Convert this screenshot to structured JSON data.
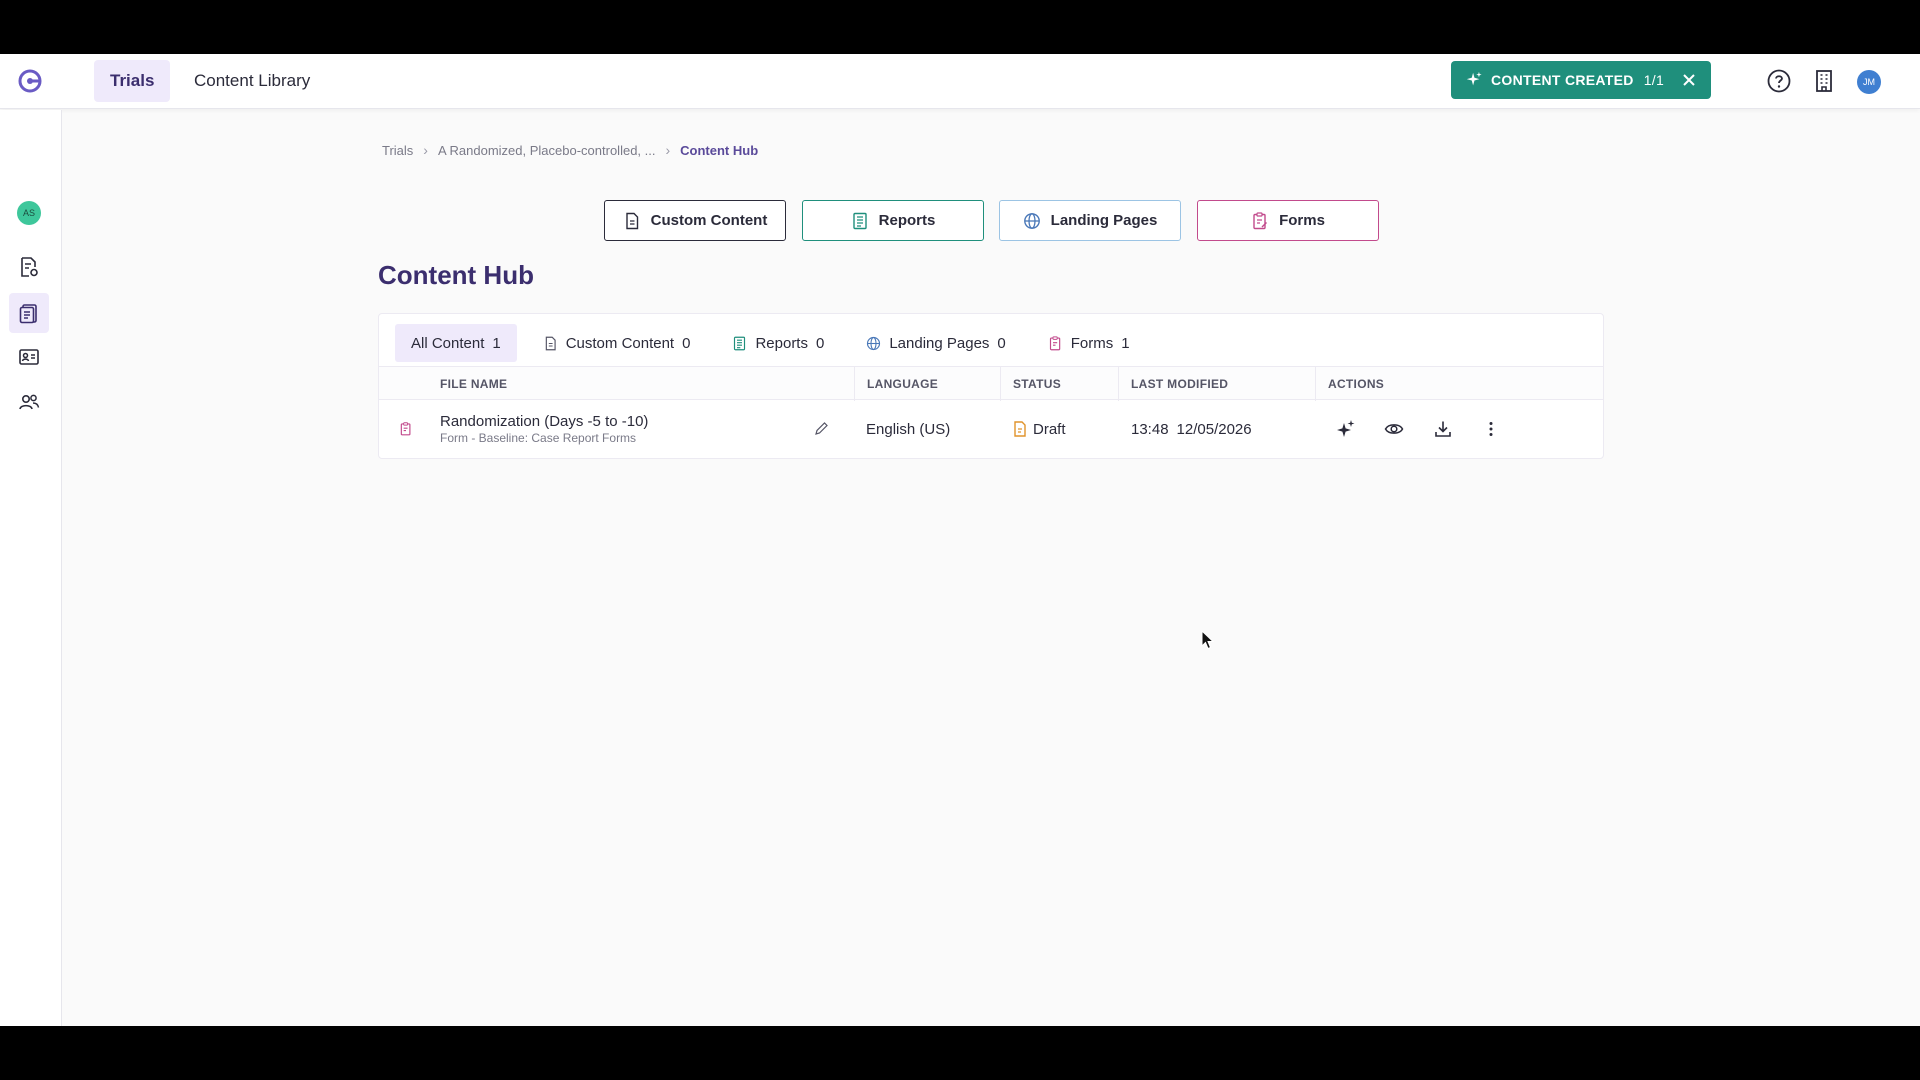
{
  "topbar": {
    "tabs": [
      {
        "label": "Trials",
        "active": true
      },
      {
        "label": "Content Library",
        "active": false
      }
    ],
    "toast": {
      "label": "CONTENT CREATED",
      "count": "1/1"
    },
    "user_initials": "JM"
  },
  "sidebar": {
    "user_initials": "AS",
    "items": [
      {
        "icon": "document-settings-icon"
      },
      {
        "icon": "clipboard-icon",
        "active": true
      },
      {
        "icon": "id-card-icon"
      },
      {
        "icon": "users-icon"
      }
    ]
  },
  "breadcrumb": {
    "items": [
      "Trials",
      "A Randomized, Placebo-controlled, ...",
      "Content Hub"
    ]
  },
  "create_buttons": [
    {
      "label": "Custom Content",
      "icon": "document-icon",
      "color": "#2b2b3a"
    },
    {
      "label": "Reports",
      "icon": "report-icon",
      "color": "#1f8f7c"
    },
    {
      "label": "Landing Pages",
      "icon": "globe-icon",
      "color": "#4a78b8"
    },
    {
      "label": "Forms",
      "icon": "form-icon",
      "color": "#c24a8c"
    }
  ],
  "page_title": "Content Hub",
  "filters": [
    {
      "label": "All Content",
      "count": "1",
      "active": true
    },
    {
      "label": "Custom Content",
      "count": "0"
    },
    {
      "label": "Reports",
      "count": "0"
    },
    {
      "label": "Landing Pages",
      "count": "0"
    },
    {
      "label": "Forms",
      "count": "1"
    }
  ],
  "table": {
    "columns": [
      "FILE NAME",
      "LANGUAGE",
      "STATUS",
      "LAST MODIFIED",
      "ACTIONS"
    ],
    "rows": [
      {
        "name": "Randomization (Days -5 to -10)",
        "subtitle": "Form - Baseline: Case Report Forms",
        "language": "English (US)",
        "status": "Draft",
        "time": "13:48",
        "date": "12/05/2026"
      }
    ]
  },
  "colors": {
    "accent": "#3b2e6e",
    "toast": "#1f8f7c",
    "form_pink": "#c24a8c",
    "draft_orange": "#e0932b"
  }
}
